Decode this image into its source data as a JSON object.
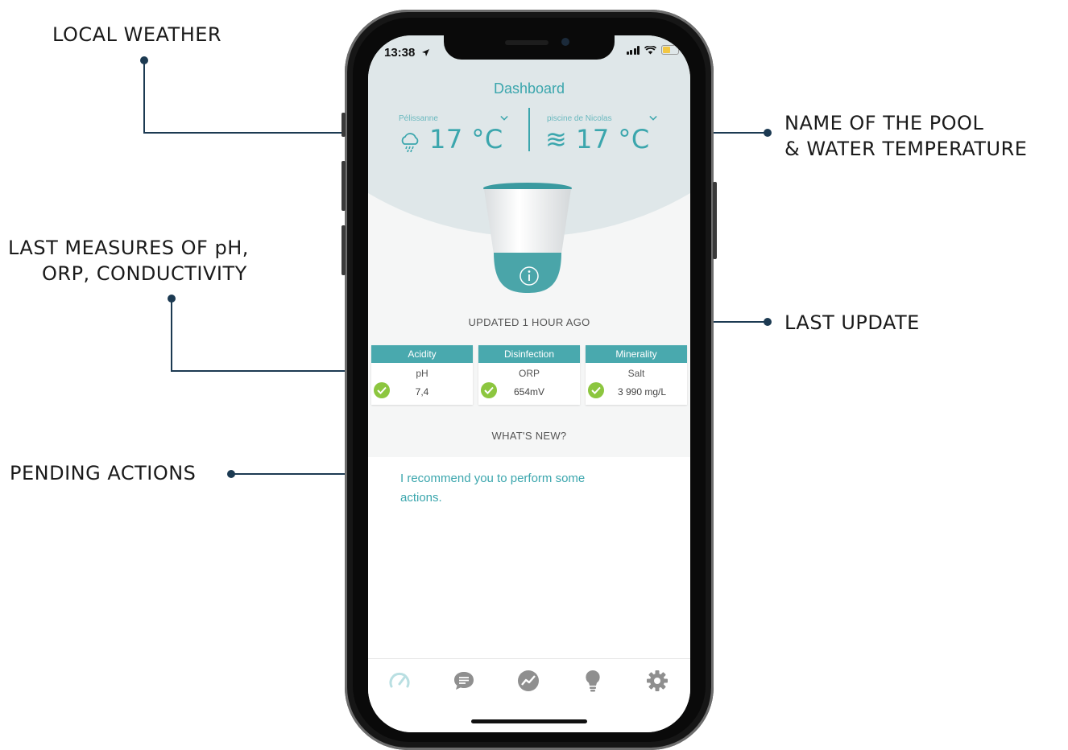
{
  "callouts": {
    "local_weather": "LOCAL WEATHER",
    "pool_name_line1": "NAME OF THE POOL",
    "pool_name_line2": "& WATER TEMPERATURE",
    "measures_line1": "LAST MEASURES OF pH,",
    "measures_line2": "ORP, CONDUCTIVITY",
    "last_update": "LAST UPDATE",
    "pending_actions": "PENDING ACTIONS"
  },
  "status_bar": {
    "time": "13:38",
    "battery_color": "#f2c744"
  },
  "header": {
    "title": "Dashboard"
  },
  "weather": {
    "location": "Pélissanne",
    "temperature": "17 °C",
    "icon": "cloud-rain-icon"
  },
  "pool": {
    "name": "piscine de Nicolas",
    "temperature": "≋ 17 °C",
    "icon": "water-waves-icon"
  },
  "updated": "UPDATED 1 HOUR AGO",
  "measures": [
    {
      "category": "Acidity",
      "label": "pH",
      "value": "7,4",
      "status": "ok"
    },
    {
      "category": "Disinfection",
      "label": "ORP",
      "value": "654mV",
      "status": "ok"
    },
    {
      "category": "Minerality",
      "label": "Salt",
      "value": "3 990 mg/L",
      "status": "ok"
    }
  ],
  "whats_new": {
    "heading": "WHAT'S NEW?",
    "message": "I recommend you to perform some actions."
  },
  "tabbar": {
    "items": [
      "gauge-icon",
      "chat-icon",
      "chart-icon",
      "lightbulb-icon",
      "gear-icon"
    ],
    "active": "gauge-icon"
  },
  "colors": {
    "accent": "#3ba6ad",
    "card_header": "#49a9ae",
    "ok_green": "#8cc63f",
    "callout_line": "#1c3a52"
  }
}
